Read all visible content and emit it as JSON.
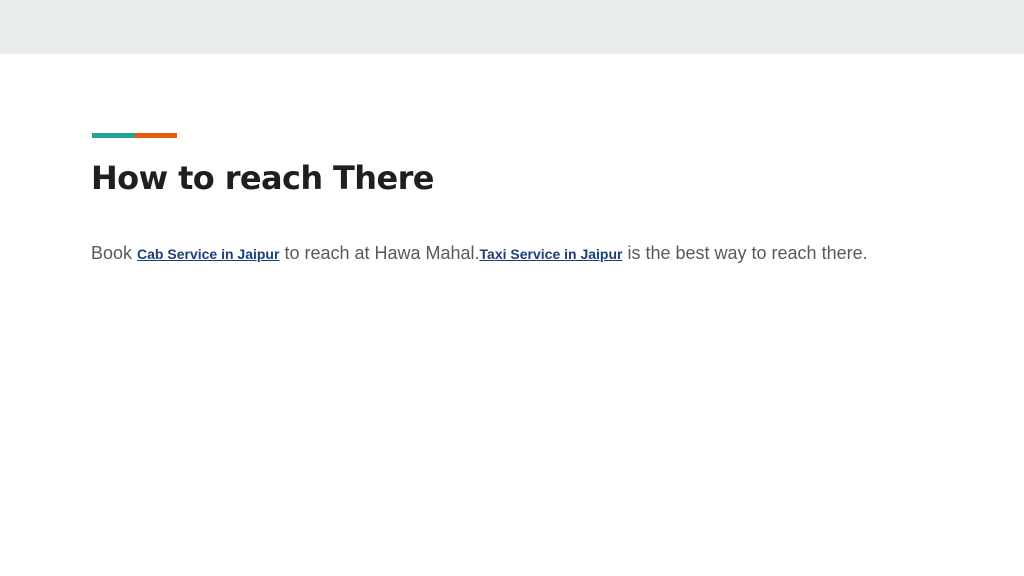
{
  "colors": {
    "top_band": "#e8ecec",
    "accent_teal": "#26a196",
    "accent_orange": "#e8590c",
    "title_text": "#1f1f1f",
    "body_text": "#595959",
    "link": "#1c3f7a"
  },
  "slide": {
    "title": "How to reach There",
    "body": {
      "part1": "Book ",
      "link1": "Cab Service in Jaipur",
      "part2": " to reach at Hawa Mahal.",
      "link2": "Taxi Service in Jaipur",
      "part3": " is the best way to reach there."
    }
  }
}
